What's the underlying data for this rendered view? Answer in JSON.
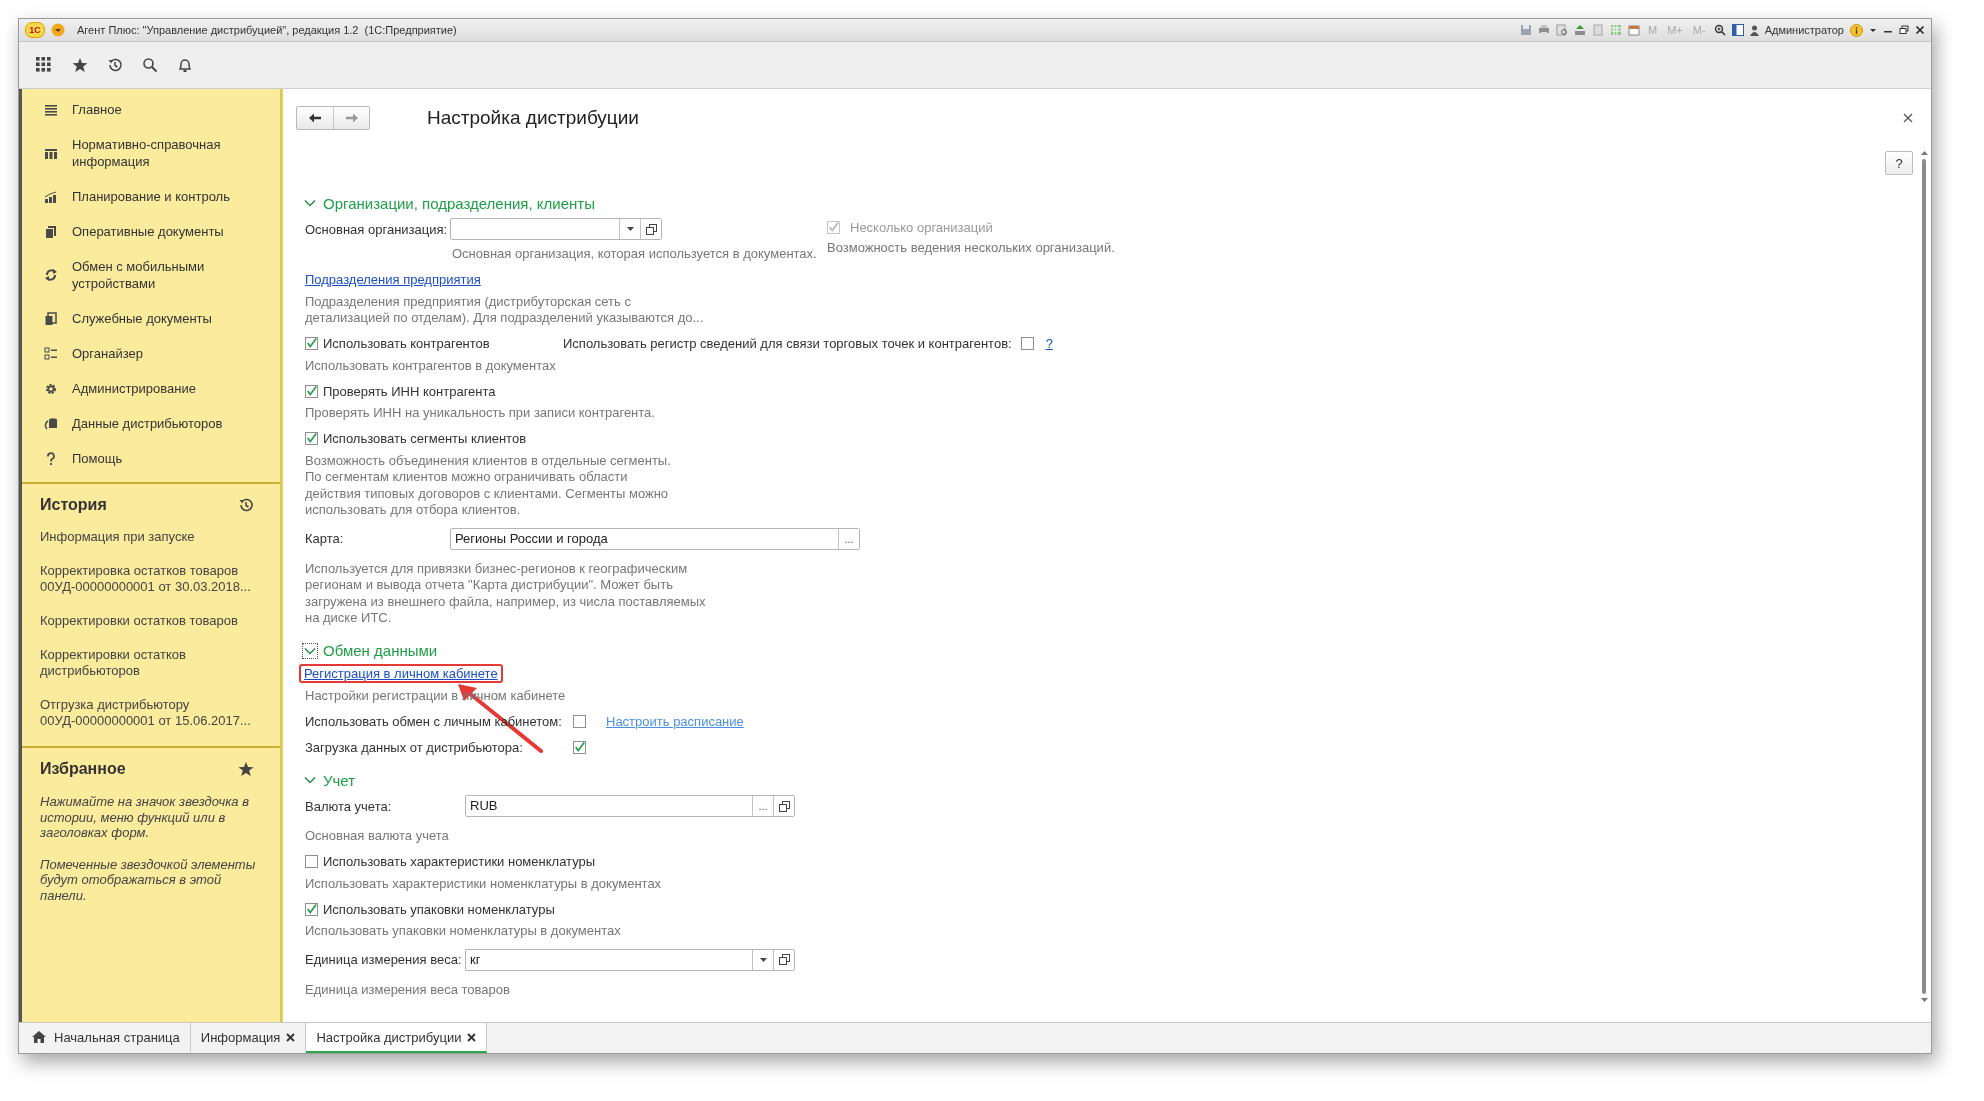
{
  "window": {
    "logo": "1С",
    "title": "Агент Плюс: \"Управление дистрибуцией\", редакция 1.2  (1С:Предприятие)",
    "memory_buttons": [
      "M",
      "M+",
      "M-"
    ],
    "user": "Администратор"
  },
  "sidebar": {
    "sections": [
      {
        "label": "Главное",
        "kind": "menu"
      },
      {
        "label": "Нормативно-справочная\nинформация",
        "kind": "catalog"
      },
      {
        "label": "Планирование и контроль",
        "kind": "chart"
      },
      {
        "label": "Оперативные документы",
        "kind": "docs"
      },
      {
        "label": "Обмен с мобильными\nустройствами",
        "kind": "sync"
      },
      {
        "label": "Служебные документы",
        "kind": "service"
      },
      {
        "label": "Органайзер",
        "kind": "organizer"
      },
      {
        "label": "Администрирование",
        "kind": "gear"
      },
      {
        "label": "Данные дистрибьюторов",
        "kind": "distributors"
      },
      {
        "label": "Помощь",
        "kind": "help"
      }
    ],
    "history": {
      "title": "История",
      "items": [
        "Информация при запуске",
        "Корректировка остатков товаров\n00УД-00000000001 от 30.03.2018...",
        "Корректировки остатков товаров",
        "Корректировки остатков\nдистрибьюторов",
        "Отгрузка дистрибьютору\n00УД-00000000001 от 15.06.2017..."
      ]
    },
    "favorites": {
      "title": "Избранное",
      "notes": [
        "Нажимайте на значок звездочка в\nистории, меню функций или в\nзаголовках форм.",
        "Помеченные звездочкой элементы\nбудут отображаться в этой\nпанели."
      ]
    }
  },
  "form": {
    "title": "Настройка дистрибуции",
    "help_button": "?",
    "groups": [
      {
        "title": "Организации, подразделения, клиенты",
        "expanded": true,
        "focused": false,
        "rows": [
          {
            "kind": "field",
            "label": "Основная организация:",
            "buttons": [
              {
                "kind": "dropdown"
              },
              {
                "kind": "open"
              }
            ],
            "hint": "Основная организация, которая используется в документах.",
            "side": {
              "label": "Несколько организаций",
              "checked": true,
              "disabled": true,
              "hint": "Возможность ведения нескольких организаций."
            }
          },
          {
            "kind": "link",
            "text": "Подразделения предприятия",
            "highlighted": false,
            "hint": "Подразделения предприятия (дистрибуторская сеть с\nдетализацией по отделам). Для подразделений указываются до..."
          },
          {
            "kind": "check",
            "label": "Использовать контрагентов",
            "checked": true,
            "hint": "Использовать контрагентов в документах",
            "side": {
              "label": "Использовать регистр сведений для связи торговых точек и контрагентов:",
              "checked": false,
              "help": "?"
            }
          },
          {
            "kind": "check",
            "label": "Проверять ИНН контрагента",
            "checked": true,
            "hint": "Проверять ИНН на уникальность при записи контрагента."
          },
          {
            "kind": "check",
            "label": "Использовать сегменты клиентов",
            "checked": true,
            "hint": "Возможность объединения клиентов в отдельные сегменты.\nПо сегментам клиентов можно ограничивать области\nдействия типовых договоров с клиентами. Сегменты можно\nиспользовать для отбора клиентов."
          },
          {
            "kind": "field",
            "label": "Карта:",
            "value": "Регионы России и города",
            "buttons": [
              {
                "kind": "choose",
                "text": "..."
              }
            ],
            "hint": "Используется для привязки бизнес-регионов к географическим\nрегионам и вывода отчета \"Карта дистрибуции\". Может быть\nзагружена из внешнего файла, например, из числа поставляемых\nна диске ИТС."
          }
        ]
      },
      {
        "title": "Обмен данными",
        "expanded": true,
        "focused": true,
        "rows": [
          {
            "kind": "link",
            "text": "Регистрация в личном кабинете",
            "highlighted": true,
            "hint": "Настройки регистрации в личном кабинете"
          },
          {
            "kind": "check_after",
            "label": "Использовать обмен с личным кабинетом:",
            "checked": false,
            "link": "Настроить расписание"
          },
          {
            "kind": "check_after",
            "label": "Загрузка данных от дистрибьютора:",
            "checked": true
          }
        ]
      },
      {
        "title": "Учет",
        "expanded": true,
        "focused": false,
        "rows": [
          {
            "kind": "field",
            "label": "Валюта учета:",
            "value": "RUB",
            "buttons": [
              {
                "kind": "choose",
                "text": "..."
              },
              {
                "kind": "open"
              }
            ],
            "hint": "Основная валюта учета"
          },
          {
            "kind": "check",
            "label": "Использовать характеристики номенклатуры",
            "checked": false,
            "hint": "Использовать характеристики номенклатуры в документах"
          },
          {
            "kind": "check",
            "label": "Использовать упаковки номенклатуры",
            "checked": true,
            "hint": "Использовать упаковки номенклатуры в документах"
          },
          {
            "kind": "field",
            "label": "Единица измерения веса:",
            "value": "кг",
            "buttons": [
              {
                "kind": "dropdown"
              },
              {
                "kind": "open"
              }
            ],
            "hint": "Единица измерения веса товаров"
          }
        ]
      }
    ]
  },
  "open_tabs": [
    {
      "label": "Начальная страница",
      "kind": "home",
      "selected": false,
      "closable": false
    },
    {
      "label": "Информация",
      "kind": "form",
      "selected": false,
      "closable": true
    },
    {
      "label": "Настройка дистрибуции",
      "kind": "form",
      "selected": true,
      "closable": true
    }
  ]
}
